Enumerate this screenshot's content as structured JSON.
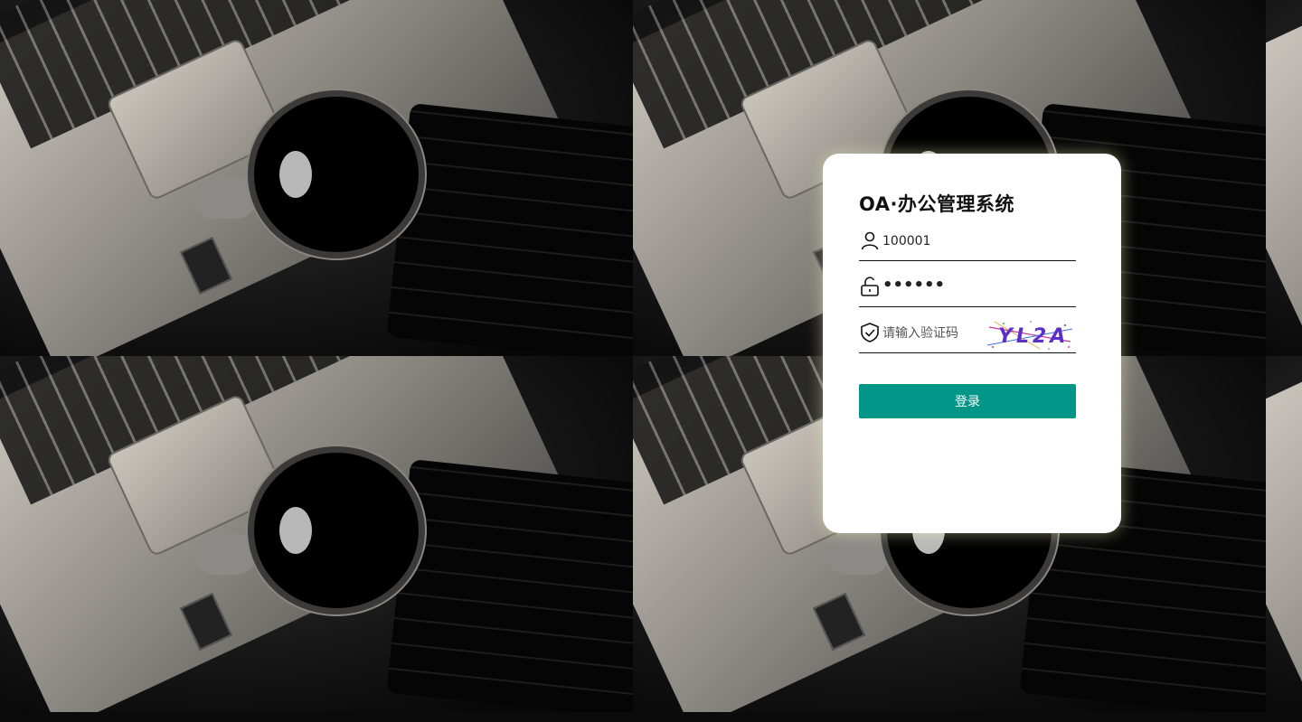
{
  "app": {
    "title": "OA·办公管理系统"
  },
  "form": {
    "username_value": "100001",
    "password_value": "••••••",
    "captcha_placeholder": "请输入验证码",
    "captcha_text": "YL2A",
    "submit_label": "登录"
  },
  "colors": {
    "primary": "#009688",
    "card_bg": "#ffffff",
    "text": "#111111"
  },
  "icons": {
    "username": "user-icon",
    "password": "unlock-icon",
    "captcha": "shield-check-icon"
  }
}
